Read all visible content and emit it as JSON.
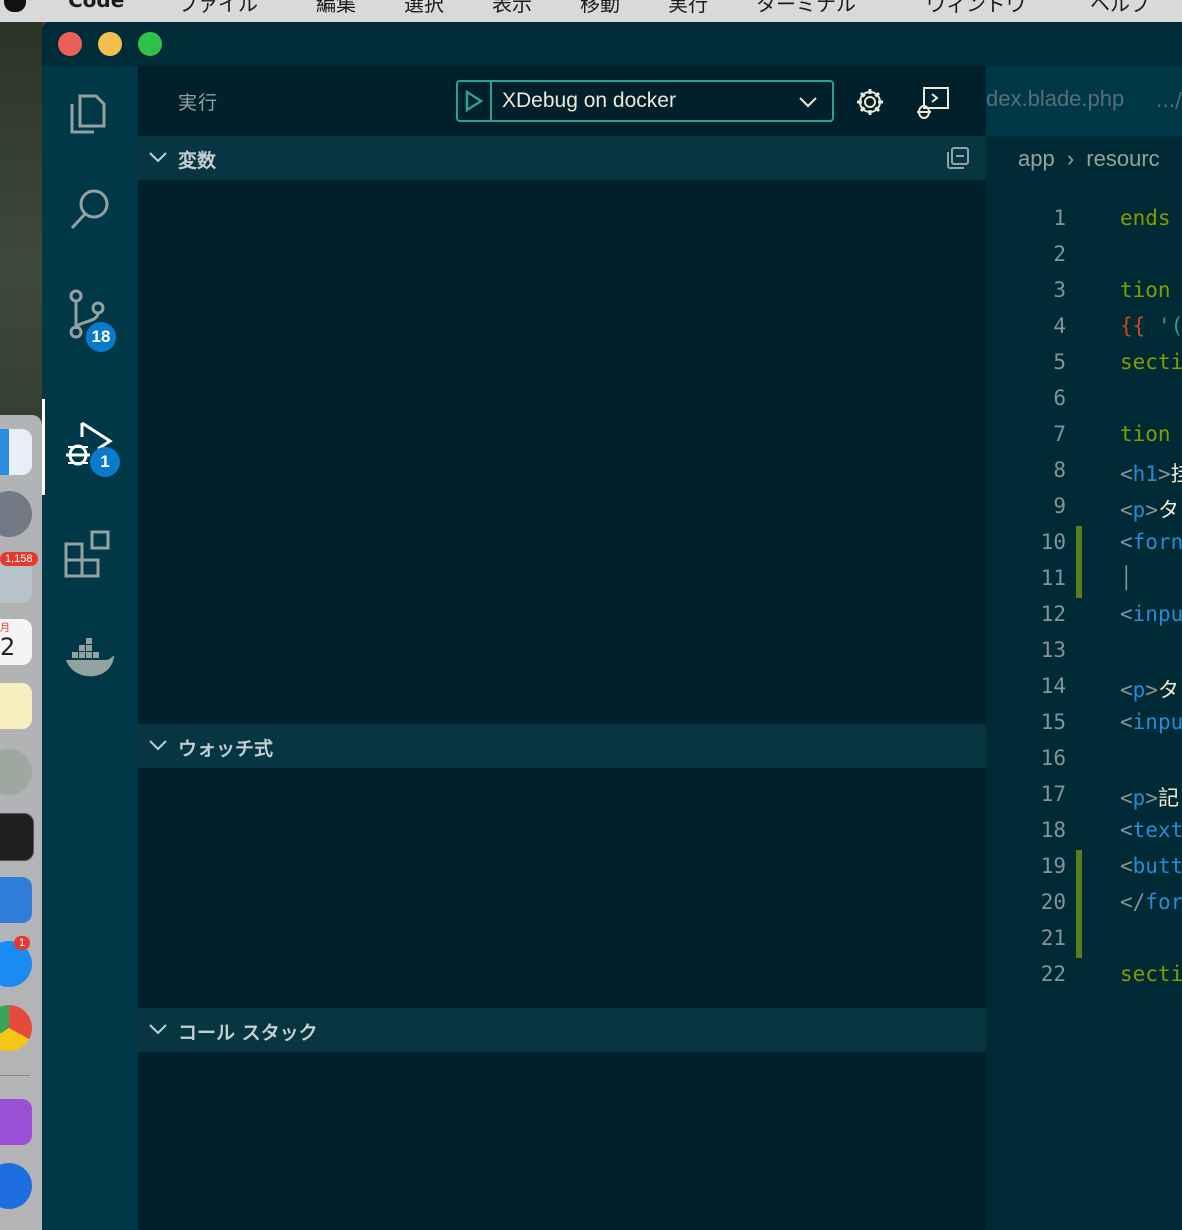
{
  "menubar": {
    "app_name": "Code",
    "items": [
      "ファイル",
      "編集",
      "選択",
      "表示",
      "移動",
      "実行",
      "ターミナル",
      "ウィンドウ",
      "ヘルプ"
    ]
  },
  "dock": {
    "mail_badge": "1,158",
    "calendar_month": "月",
    "calendar_day": "2",
    "appstore_badge": "1"
  },
  "activity_bar": {
    "items": [
      {
        "name": "explorer",
        "icon": "files-icon"
      },
      {
        "name": "search",
        "icon": "search-icon"
      },
      {
        "name": "source-control",
        "icon": "source-control-icon",
        "badge": "18"
      },
      {
        "name": "run-debug",
        "icon": "debug-icon",
        "badge": "1",
        "active": true
      },
      {
        "name": "extensions",
        "icon": "extensions-icon"
      },
      {
        "name": "docker",
        "icon": "docker-icon"
      }
    ]
  },
  "sidebar": {
    "title": "実行",
    "debug_config": "XDebug on docker",
    "sections": {
      "variables": "変数",
      "watch": "ウォッチ式",
      "callstack": "コール スタック"
    }
  },
  "editor": {
    "tab_label": "dex.blade.php",
    "tab_path": ".../",
    "breadcrumb": [
      "app",
      "resourc"
    ],
    "lines": [
      {
        "n": "1",
        "tokens": [
          {
            "t": "ends",
            "c": "kw"
          }
        ],
        "mark": false
      },
      {
        "n": "2",
        "tokens": [],
        "mark": false
      },
      {
        "n": "3",
        "tokens": [
          {
            "t": "tion",
            "c": "kw"
          }
        ],
        "mark": false
      },
      {
        "n": "4",
        "tokens": [
          {
            "t": "{{ ",
            "c": "brace"
          },
          {
            "t": "'(",
            "c": "str"
          }
        ],
        "mark": false
      },
      {
        "n": "5",
        "tokens": [
          {
            "t": "secti",
            "c": "kw"
          }
        ],
        "mark": false
      },
      {
        "n": "6",
        "tokens": [],
        "mark": false
      },
      {
        "n": "7",
        "tokens": [
          {
            "t": "tion",
            "c": "kw"
          }
        ],
        "mark": false
      },
      {
        "n": "8",
        "tokens": [
          {
            "t": "<",
            "c": "punc"
          },
          {
            "t": "h1",
            "c": "tag"
          },
          {
            "t": ">",
            "c": "punc"
          },
          {
            "t": "挂",
            "c": "text"
          }
        ],
        "mark": false
      },
      {
        "n": "9",
        "tokens": [
          {
            "t": "<",
            "c": "punc"
          },
          {
            "t": "p",
            "c": "tag"
          },
          {
            "t": ">",
            "c": "punc"
          },
          {
            "t": "タ",
            "c": "text"
          }
        ],
        "mark": false
      },
      {
        "n": "10",
        "tokens": [
          {
            "t": "<",
            "c": "punc"
          },
          {
            "t": "forn",
            "c": "tag"
          }
        ],
        "mark": true
      },
      {
        "n": "11",
        "tokens": [
          {
            "t": "│    ",
            "c": "punc"
          },
          {
            "t": "(",
            "c": "kw"
          }
        ],
        "mark": true
      },
      {
        "n": "12",
        "tokens": [
          {
            "t": "<",
            "c": "punc"
          },
          {
            "t": "inpu",
            "c": "tag"
          }
        ],
        "mark": false
      },
      {
        "n": "13",
        "tokens": [],
        "mark": false
      },
      {
        "n": "14",
        "tokens": [
          {
            "t": "<",
            "c": "punc"
          },
          {
            "t": "p",
            "c": "tag"
          },
          {
            "t": ">",
            "c": "punc"
          },
          {
            "t": "タ",
            "c": "text"
          }
        ],
        "mark": false
      },
      {
        "n": "15",
        "tokens": [
          {
            "t": "<",
            "c": "punc"
          },
          {
            "t": "inpu",
            "c": "tag"
          }
        ],
        "mark": false
      },
      {
        "n": "16",
        "tokens": [],
        "mark": false
      },
      {
        "n": "17",
        "tokens": [
          {
            "t": "<",
            "c": "punc"
          },
          {
            "t": "p",
            "c": "tag"
          },
          {
            "t": ">",
            "c": "punc"
          },
          {
            "t": "記",
            "c": "text"
          }
        ],
        "mark": false
      },
      {
        "n": "18",
        "tokens": [
          {
            "t": "<",
            "c": "punc"
          },
          {
            "t": "text",
            "c": "tag"
          }
        ],
        "mark": false
      },
      {
        "n": "19",
        "tokens": [
          {
            "t": "<",
            "c": "punc"
          },
          {
            "t": "butt",
            "c": "tag"
          }
        ],
        "mark": true
      },
      {
        "n": "20",
        "tokens": [
          {
            "t": "</",
            "c": "punc"
          },
          {
            "t": "for",
            "c": "tag"
          }
        ],
        "mark": true
      },
      {
        "n": "21",
        "tokens": [],
        "mark": true
      },
      {
        "n": "22",
        "tokens": [
          {
            "t": "secti",
            "c": "kw"
          }
        ],
        "mark": false
      }
    ]
  },
  "colors": {
    "sidebar_bg": "#00212b",
    "editor_bg": "#002b36",
    "accent": "#2aa198",
    "badge": "#0a7acc",
    "gutter_modified": "#5b7d1c"
  }
}
